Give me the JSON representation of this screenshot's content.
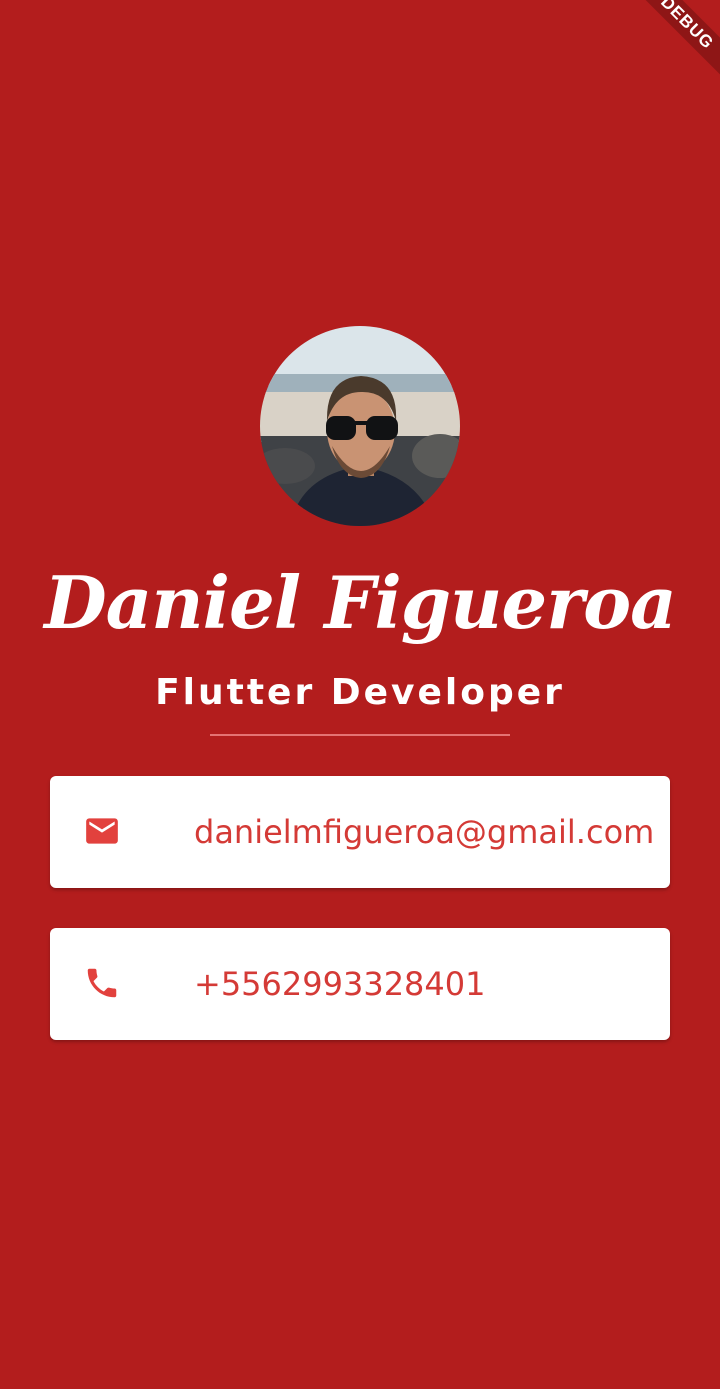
{
  "debug_banner": {
    "label": "DEBUG"
  },
  "profile": {
    "name": "Daniel Figueroa",
    "title": "Flutter Developer"
  },
  "contacts": {
    "email": {
      "icon": "mail-icon",
      "value": "danielmfigueroa@gmail.com"
    },
    "phone": {
      "icon": "phone-icon",
      "value": "+5562993328401"
    }
  },
  "colors": {
    "background": "#b31d1d",
    "card": "#ffffff",
    "accent": "#d43a36",
    "divider": "#e57373"
  }
}
